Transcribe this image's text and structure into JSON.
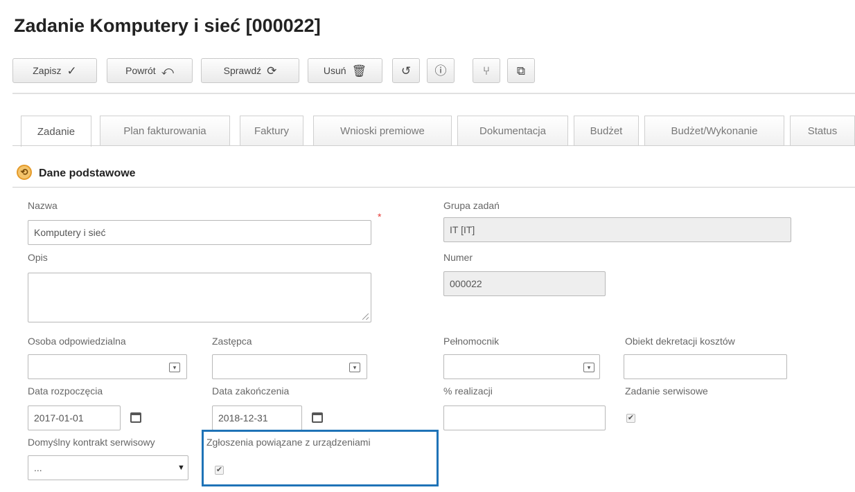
{
  "title": "Zadanie Komputery i sieć [000022]",
  "toolbar": {
    "save": {
      "label": "Zapisz",
      "icon": "✓"
    },
    "back": {
      "label": "Powrót",
      "icon": "⤺"
    },
    "check": {
      "label": "Sprawdź",
      "icon": "⟳"
    },
    "delete": {
      "label": "Usuń",
      "icon": "🗑"
    },
    "history_icon": "↺",
    "info_icon": "ⓘ",
    "branch_icon": "⑂",
    "copy_icon": "⧉"
  },
  "tabs": [
    {
      "label": "Zadanie"
    },
    {
      "label": "Plan fakturowania"
    },
    {
      "label": "Faktury"
    },
    {
      "label": "Wnioski premiowe"
    },
    {
      "label": "Dokumentacja"
    },
    {
      "label": "Budżet"
    },
    {
      "label": "Budżet/Wykonanie"
    },
    {
      "label": "Status"
    }
  ],
  "section": {
    "title": "Dane podstawowe",
    "icon": "⟲"
  },
  "fields": {
    "nazwa": {
      "label": "Nazwa",
      "value": "Komputery i sieć",
      "required": "*"
    },
    "grupa": {
      "label": "Grupa zadań",
      "value": "IT [IT]"
    },
    "opis": {
      "label": "Opis",
      "value": ""
    },
    "numer": {
      "label": "Numer",
      "value": "000022"
    },
    "osoba": {
      "label": "Osoba odpowiedzialna",
      "value": ""
    },
    "zastepca": {
      "label": "Zastępca",
      "value": ""
    },
    "pelnomocnik": {
      "label": "Pełnomocnik",
      "value": ""
    },
    "obiekt": {
      "label": "Obiekt dekretacji kosztów",
      "value": ""
    },
    "data_rozp": {
      "label": "Data rozpoczęcia",
      "value": "2017-01-01"
    },
    "data_zak": {
      "label": "Data zakończenia",
      "value": "2018-12-31"
    },
    "realizacja": {
      "label": "% realizacji",
      "value": ""
    },
    "serwisowe": {
      "label": "Zadanie serwisowe",
      "checked": "✔"
    },
    "kontrakt": {
      "label": "Domyślny kontrakt serwisowy",
      "value": "..."
    },
    "zgloszenia": {
      "label": "Zgłoszenia powiązane z urządzeniami",
      "checked": "✔"
    }
  },
  "colors": {
    "highlight": "#1f73b7",
    "required": "#e53935",
    "readonly_bg": "#eeeeee"
  }
}
